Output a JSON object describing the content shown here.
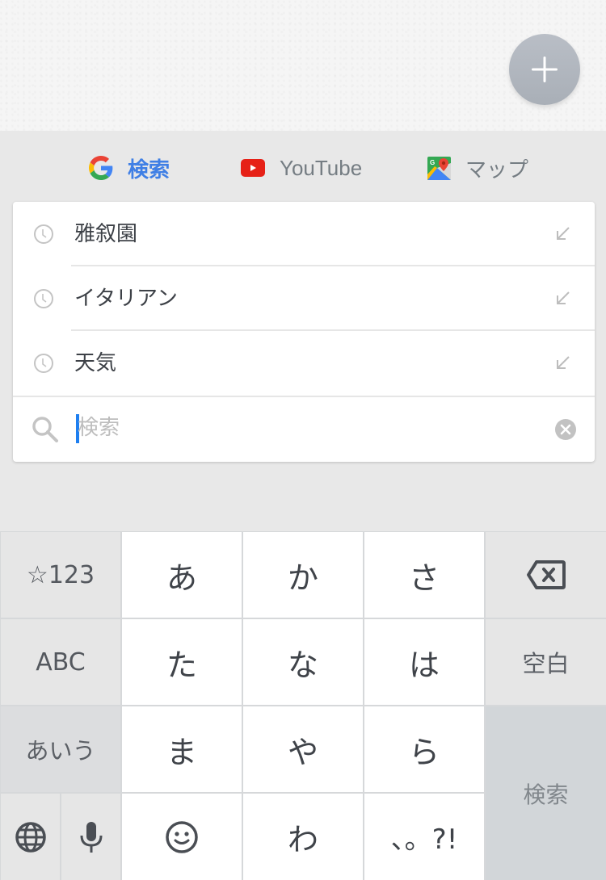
{
  "fab": {
    "icon": "plus-icon"
  },
  "tabs": [
    {
      "id": "search",
      "label": "検索",
      "icon": "google-g-icon",
      "active": true
    },
    {
      "id": "youtube",
      "label": "YouTube",
      "icon": "youtube-icon",
      "active": false
    },
    {
      "id": "maps",
      "label": "マップ",
      "icon": "google-maps-icon",
      "active": false
    }
  ],
  "history": [
    {
      "text": "雅叙園",
      "icon": "clock-icon",
      "action_icon": "arrow-up-left-icon"
    },
    {
      "text": "イタリアン",
      "icon": "clock-icon",
      "action_icon": "arrow-up-left-icon"
    },
    {
      "text": "天気",
      "icon": "clock-icon",
      "action_icon": "arrow-up-left-icon"
    }
  ],
  "search": {
    "placeholder": "検索",
    "value": ""
  },
  "keyboard": {
    "mode_symbols": "☆123",
    "mode_abc": "ABC",
    "mode_kana": "あいう",
    "space": "空白",
    "enter": "検索",
    "rows": [
      [
        "あ",
        "か",
        "さ"
      ],
      [
        "た",
        "な",
        "は"
      ],
      [
        "ま",
        "や",
        "ら"
      ],
      [
        "emoji",
        "わ",
        "、。?!"
      ]
    ]
  },
  "colors": {
    "accent": "#3f7fe5",
    "caret": "#1e7ff0",
    "tab_inactive": "#757d83",
    "youtube_red": "#e62117"
  }
}
